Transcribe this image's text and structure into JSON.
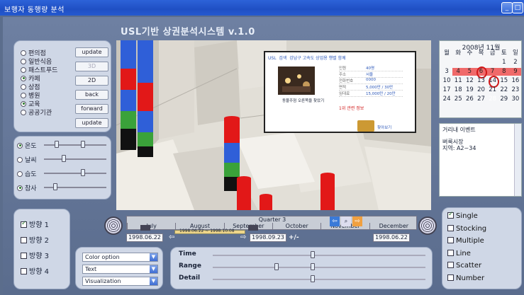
{
  "window": {
    "title": "보행자 동행량 분석",
    "buttons": [
      "_",
      "□",
      "×"
    ]
  },
  "app": {
    "title": "USL기반 상권분석시스템  v.1.0"
  },
  "categories": [
    {
      "label": "편의점",
      "checked": false
    },
    {
      "label": "일반식음",
      "checked": false
    },
    {
      "label": "패스트푸드",
      "checked": false
    },
    {
      "label": "카페",
      "checked": true
    },
    {
      "label": "상점",
      "checked": false
    },
    {
      "label": "병원",
      "checked": false
    },
    {
      "label": "교육",
      "checked": true
    },
    {
      "label": "공공기관",
      "checked": false
    }
  ],
  "view_buttons": [
    {
      "label": "update",
      "enabled": true
    },
    {
      "label": "3D",
      "enabled": false
    },
    {
      "label": "2D",
      "enabled": true
    },
    {
      "label": "back",
      "enabled": true
    },
    {
      "label": "forward",
      "enabled": true
    },
    {
      "label": "update",
      "enabled": true
    }
  ],
  "environment": [
    {
      "label": "온도",
      "checked": true,
      "thumbs": [
        0.2,
        0.62
      ]
    },
    {
      "label": "날씨",
      "checked": false,
      "thumbs": [
        0.32
      ]
    },
    {
      "label": "습도",
      "checked": false,
      "thumbs": [
        0.62
      ]
    },
    {
      "label": "참사",
      "checked": true,
      "thumbs": [
        0.18
      ]
    }
  ],
  "calendar": {
    "header": "2008년 11월",
    "weekdays": [
      "월",
      "화",
      "수",
      "목",
      "금",
      "토",
      "일"
    ],
    "days": [
      "",
      "",
      "",
      "",
      "",
      "1",
      "2",
      "3",
      "4",
      "5",
      "6",
      "7",
      "8",
      "9",
      "10",
      "11",
      "12",
      "13",
      "14",
      "15",
      "16",
      "17",
      "18",
      "19",
      "20",
      "21",
      "22",
      "23",
      "24",
      "25",
      "26",
      "27",
      "28",
      "29",
      "30"
    ],
    "highlighted": [
      "4",
      "5",
      "6",
      "7",
      "8",
      "9"
    ],
    "circled": [
      "6",
      "14"
    ],
    "today": "28"
  },
  "events": {
    "title": "거리내 이벤트",
    "lines": [
      "벼룩시장",
      "지역: A2~34"
    ]
  },
  "timeline": {
    "quarter": "Quarter 3",
    "months": [
      "July",
      "August",
      "September",
      "October",
      "November",
      "December"
    ],
    "range_label": "1998.06.22 ~ 1998.10.08",
    "start_date": "1998.06.22",
    "mid_date": "1998.09.23",
    "end_date": "1998.06.22",
    "pm": "+/-"
  },
  "directions": [
    {
      "label": "방향 1",
      "checked": true
    },
    {
      "label": "방향 2",
      "checked": false
    },
    {
      "label": "방향 3",
      "checked": false
    },
    {
      "label": "방향 4",
      "checked": false
    }
  ],
  "options": [
    "Color option",
    "Text",
    "Visualization"
  ],
  "controls": [
    {
      "label": "Time",
      "thumbs": [
        0.47
      ]
    },
    {
      "label": "Range",
      "thumbs": [
        0.3,
        0.47
      ]
    },
    {
      "label": "Detail",
      "thumbs": [
        0.47
      ]
    }
  ],
  "view_types": [
    {
      "label": "Single",
      "checked": true
    },
    {
      "label": "Stocking",
      "checked": false
    },
    {
      "label": "Multiple",
      "checked": false
    },
    {
      "label": "Line",
      "checked": false
    },
    {
      "label": "Scatter",
      "checked": false
    },
    {
      "label": "Number",
      "checked": false
    }
  ],
  "popup": {
    "header": [
      "USL",
      "검색",
      "강남구 고속도 상업용 행렬 함께"
    ],
    "caption": "동물주점 오른쪽을 찾았기",
    "rows": [
      "인원",
      "주소",
      "전화번호",
      "면적",
      "임대료"
    ],
    "values": [
      "40명",
      "서울",
      "0000",
      "5,000만 / 30만",
      "15,000만 / 20만"
    ],
    "note": "1위 관련 정보",
    "footer": "찾아보기"
  },
  "colors": {
    "accent": "#2d63d8",
    "panel": "#cfd7e6",
    "pillar_red": "#e21818",
    "pillar_blue": "#2f5fd8",
    "pillar_green": "#3aa23a"
  }
}
